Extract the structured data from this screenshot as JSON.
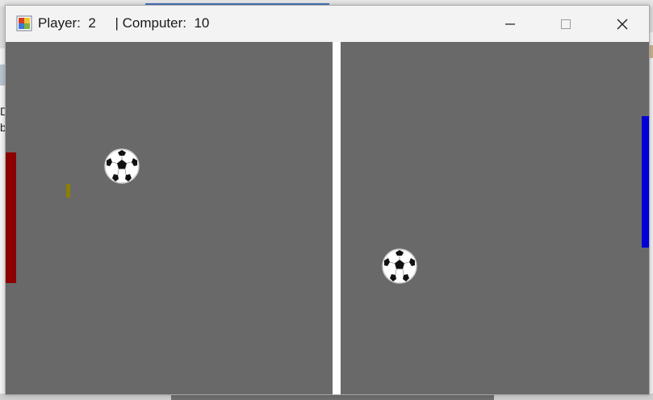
{
  "window": {
    "title_player_label": "Player:",
    "player_score": "2",
    "title_computer_label": "| Computer:",
    "computer_score": "10"
  },
  "background": {
    "left_text_1": "D",
    "left_text_2": "b"
  },
  "icons": {
    "app": "app-icon",
    "minimize": "minimize-icon",
    "maximize": "maximize-icon",
    "close": "close-icon",
    "ball": "soccer-ball-icon"
  },
  "colors": {
    "field": "#696969",
    "net": "#ffffff",
    "player_paddle": "#8b0000",
    "computer_paddle": "#0000d6",
    "marker": "#8b8000"
  }
}
